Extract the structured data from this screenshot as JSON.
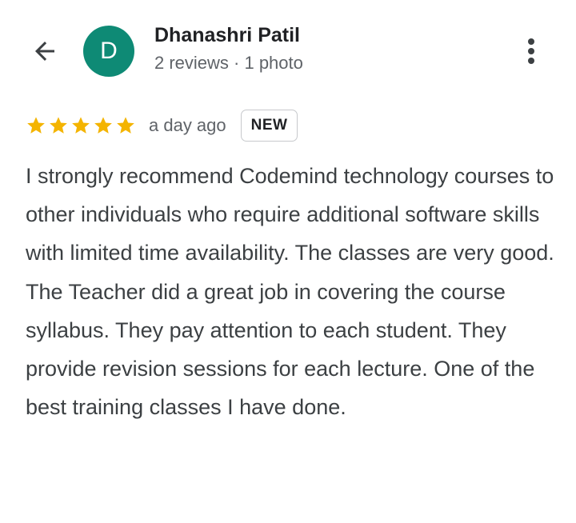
{
  "header": {
    "back_icon": "arrow-left-icon",
    "avatar_letter": "D",
    "avatar_color": "#0e8a75",
    "reviewer_name": "Dhanashri Patil",
    "reviewer_meta": "2 reviews · 1 photo",
    "more_icon": "more-vert-icon"
  },
  "review": {
    "rating": 5,
    "max_rating": 5,
    "star_color": "#f4b400",
    "time": "a day ago",
    "badge": "NEW",
    "text": "I strongly recommend Codemind technology courses to other individuals who require additional software skills with limited time availability. The classes are very good. The Teacher did a great job in covering the course syllabus. They pay attention to each student. They provide revision sessions for each lecture. One of the best training classes I have done."
  }
}
